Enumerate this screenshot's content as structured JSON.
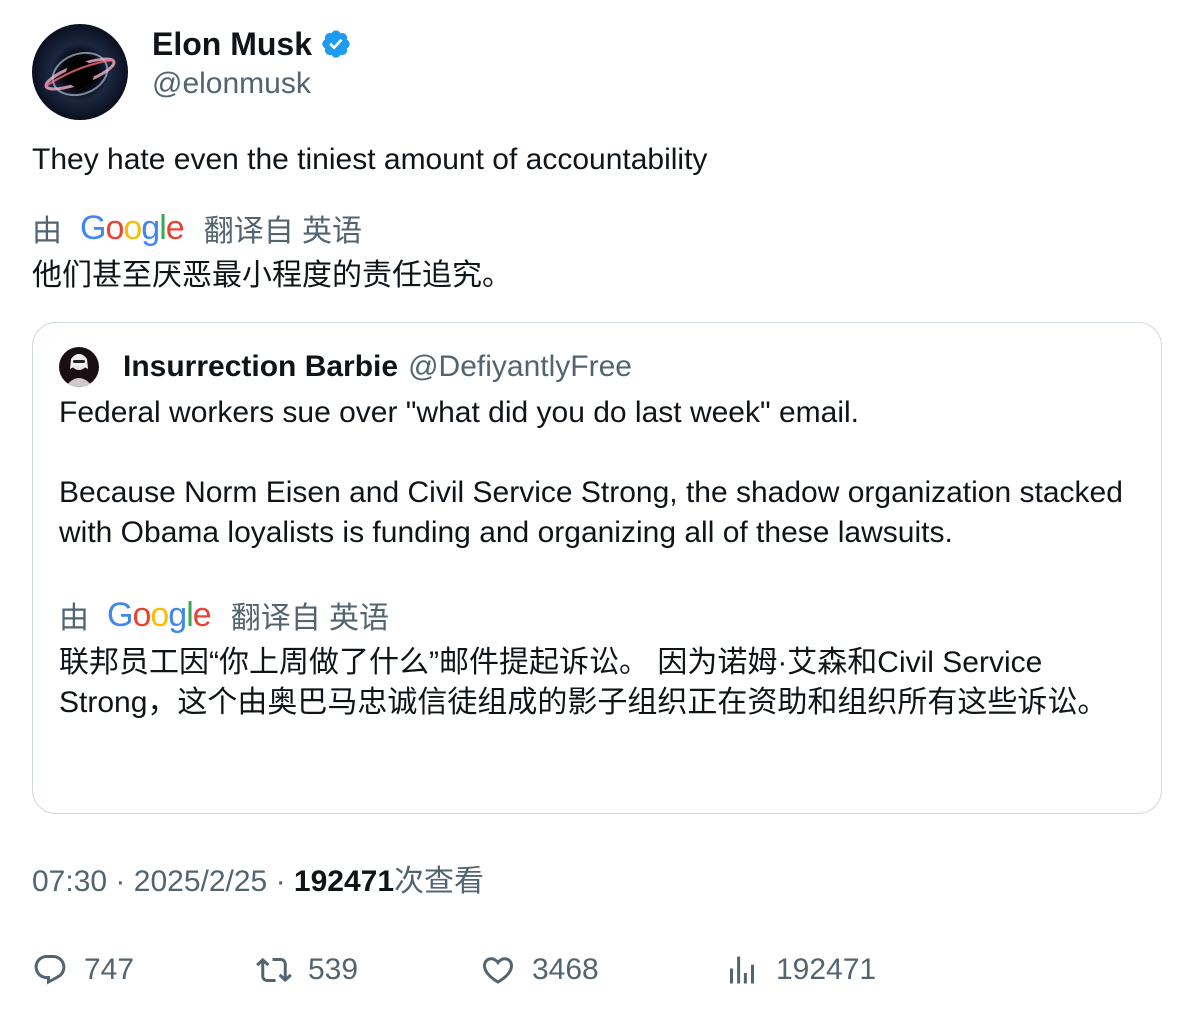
{
  "tweet": {
    "author": {
      "name": "Elon Musk",
      "handle": "@elonmusk",
      "verified": true
    },
    "text": "They hate even the tiniest amount of accountability",
    "translation": {
      "by_label": "由",
      "provider": "Google",
      "from_label": "翻译自 英语",
      "text": "他们甚至厌恶最小程度的责任追究。"
    },
    "quote": {
      "author_name": "Insurrection Barbie",
      "author_handle": "@DefiyantlyFree",
      "paragraphs": [
        "Federal workers sue over \"what did you do last week\" email.",
        "Because Norm Eisen and Civil Service Strong, the shadow organization stacked with Obama loyalists is funding and organizing all of these lawsuits."
      ],
      "translation": {
        "by_label": "由",
        "provider": "Google",
        "from_label": "翻译自 英语",
        "text": "联邦员工因“你上周做了什么”邮件提起诉讼。 因为诺姆·艾森和Civil Service Strong，这个由奥巴马忠诚信徒组成的影子组织正在资助和组织所有这些诉讼。"
      }
    },
    "meta": {
      "time": "07:30",
      "separator": "·",
      "date": "2025/2/25",
      "views_count": "192471",
      "views_label": "次查看"
    },
    "actions": {
      "replies": "747",
      "reposts": "539",
      "likes": "3468",
      "views": "192471"
    }
  },
  "colors": {
    "text_primary": "#0f1419",
    "text_secondary": "#536471",
    "verified_blue": "#1d9bf0",
    "border": "#cfd9de"
  },
  "icons": [
    "verified-badge-icon",
    "google-logo",
    "reply-icon",
    "repost-icon",
    "like-icon",
    "views-icon"
  ]
}
